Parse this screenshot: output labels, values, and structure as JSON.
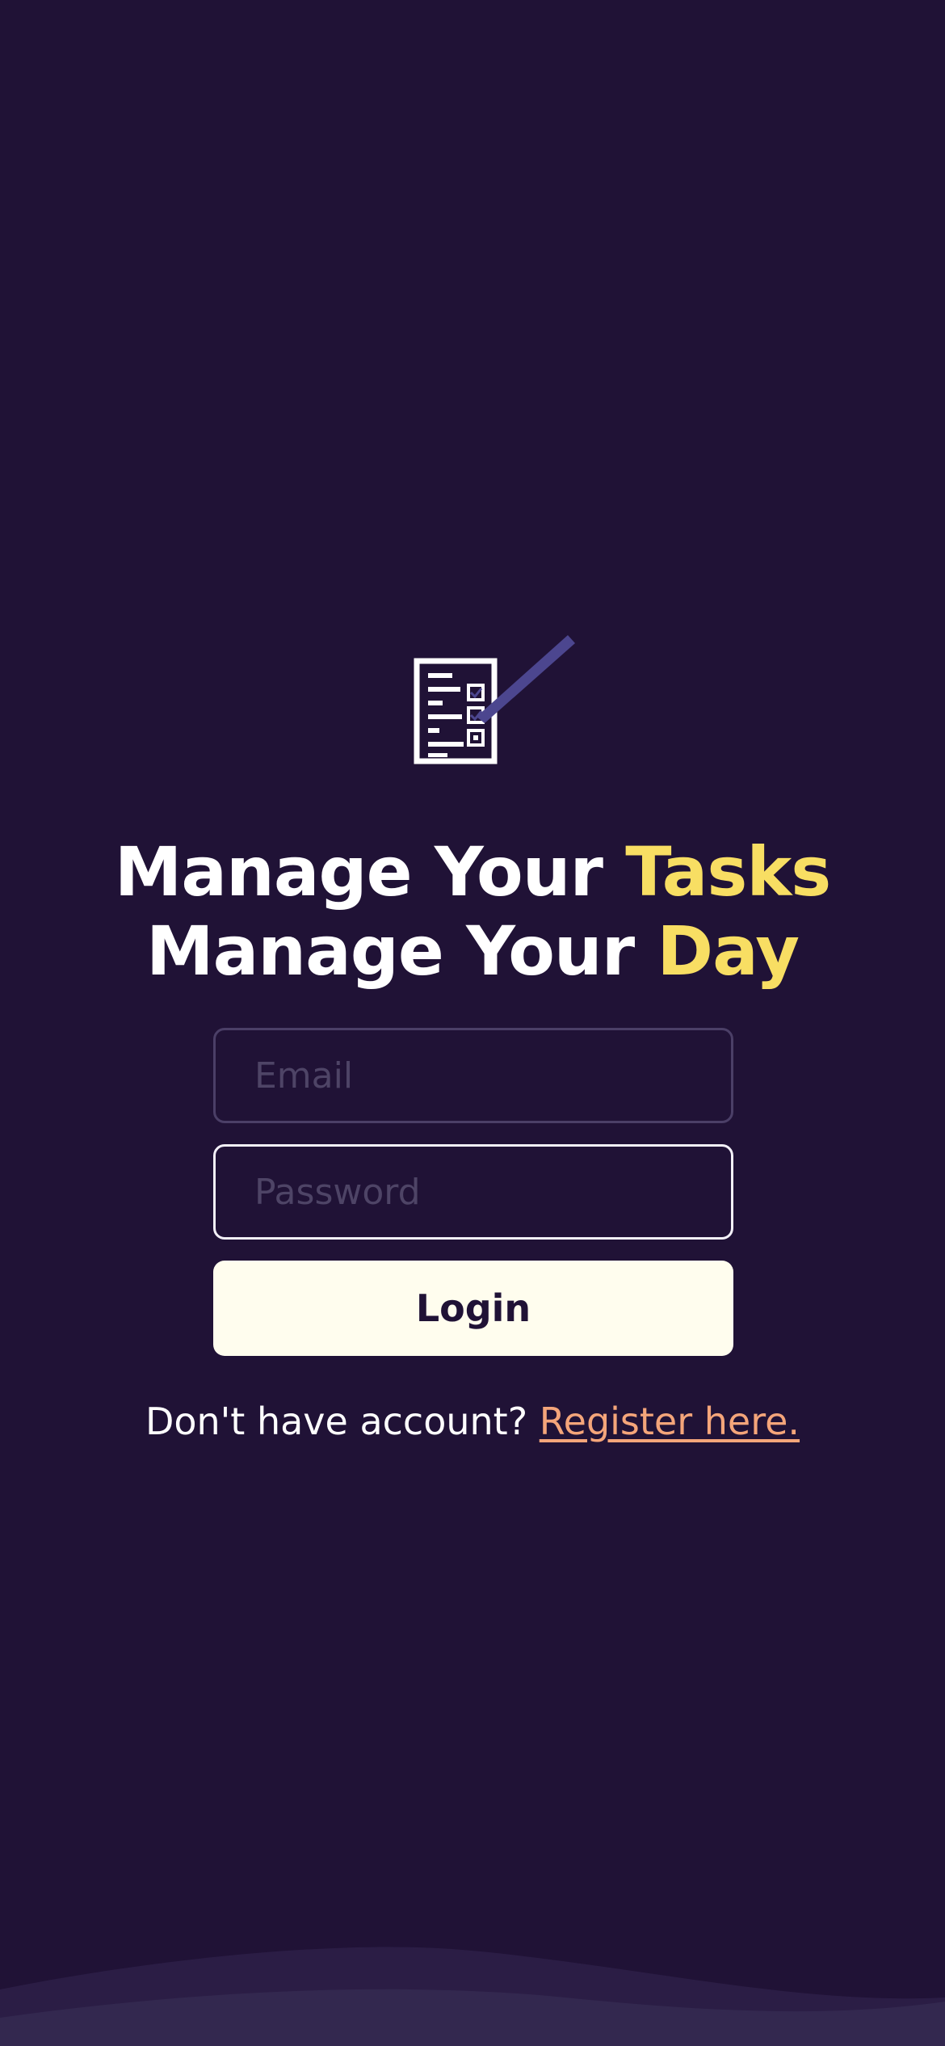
{
  "branding": {
    "logo_icon": "task-checklist-pencil-icon",
    "headline_line1_text": "Manage Your ",
    "headline_line1_accent": "Tasks",
    "headline_line2_text": "Manage Your ",
    "headline_line2_accent": "Day"
  },
  "form": {
    "email_placeholder": "Email",
    "email_value": "",
    "password_placeholder": "Password",
    "password_value": "",
    "login_label": "Login"
  },
  "register": {
    "prompt": "Don't have account? ",
    "link_label": "Register here."
  },
  "colors": {
    "background": "#201236",
    "accent_yellow": "#f8de63",
    "link_orange": "#f4a57a",
    "button_bg": "#fffdee",
    "pencil": "#4c468f"
  }
}
